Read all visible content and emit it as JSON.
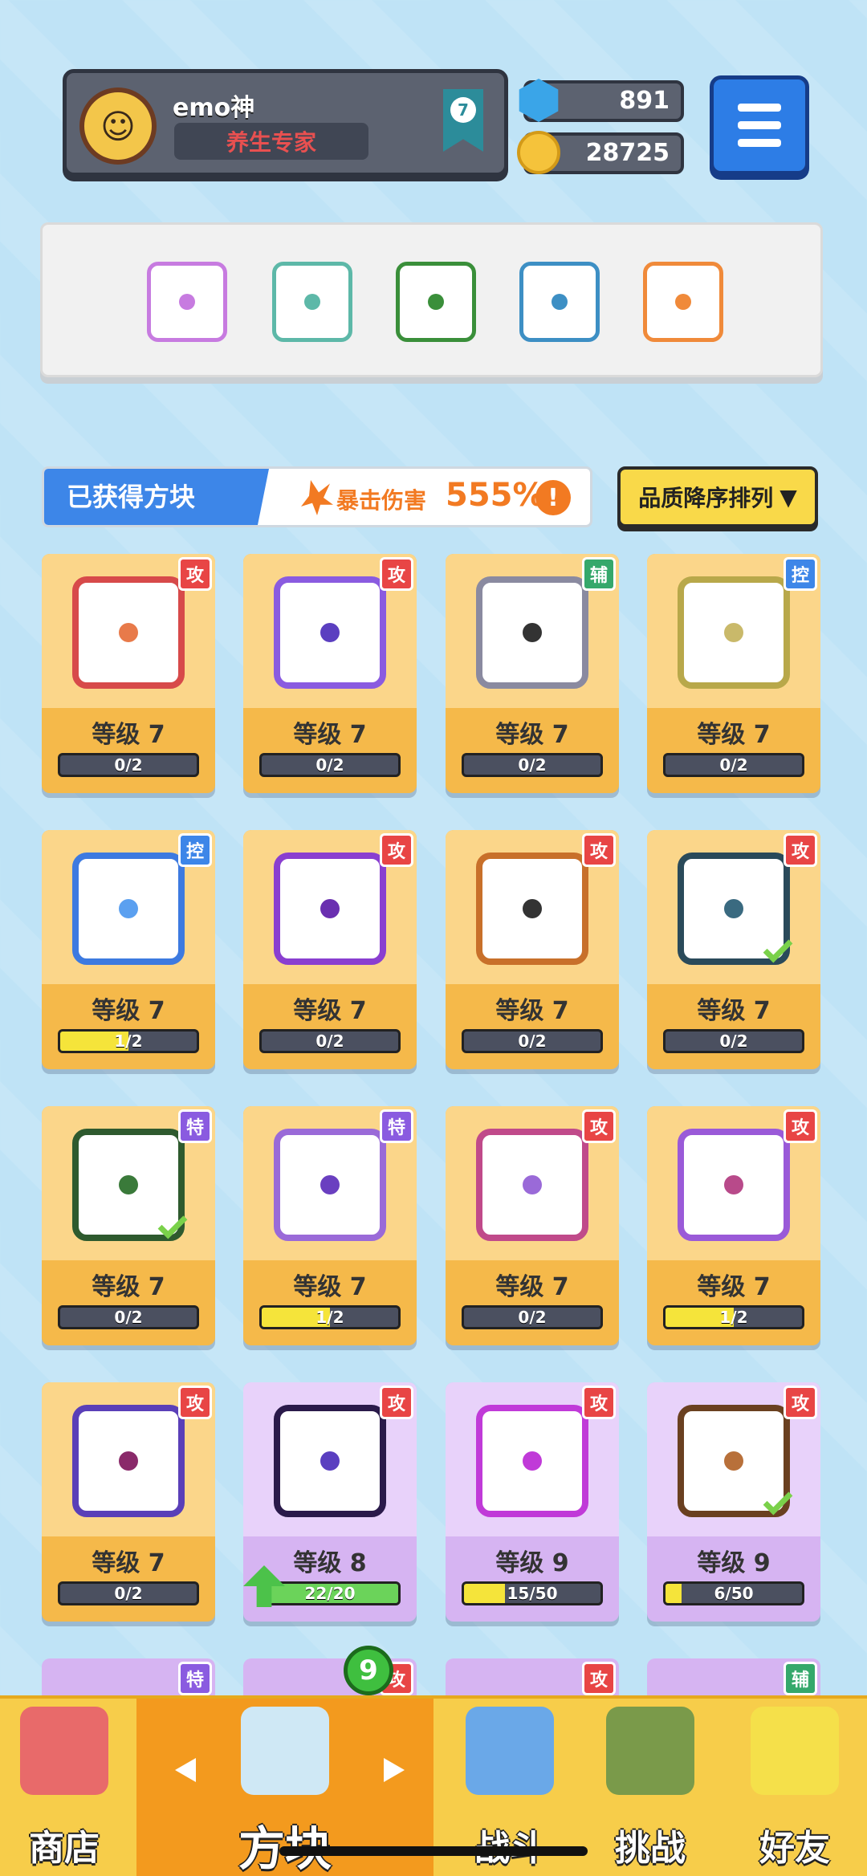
{
  "player": {
    "name": "emo神",
    "title": "养生专家",
    "rank": "7"
  },
  "currency": {
    "gems": "891",
    "coins": "28725"
  },
  "equipped_slots": [
    {
      "name": "rainbow-block",
      "color": "#c77be0"
    },
    {
      "name": "heal-block",
      "color": "#5db8a8"
    },
    {
      "name": "vine-block",
      "color": "#3a8f3a"
    },
    {
      "name": "vortex-block",
      "color": "#3d8fc4"
    },
    {
      "name": "target-block",
      "color": "#f08a3a"
    }
  ],
  "section": {
    "title": "已获得方块",
    "crit_label": "暴击伤害",
    "crit_value": "555%",
    "info": "!",
    "sort_label": "品质降序排列",
    "sort_arrow": "▼"
  },
  "cards": [
    {
      "type": "攻",
      "type_class": "atk",
      "level": "等级 7",
      "progress": "0/2",
      "fill": 0,
      "frame": "#d74a4a",
      "dot": "#e87a4a",
      "rarity": "gold"
    },
    {
      "type": "攻",
      "type_class": "atk",
      "level": "等级 7",
      "progress": "0/2",
      "fill": 0,
      "frame": "#8a5be0",
      "dot": "#5b3fc0",
      "rarity": "gold"
    },
    {
      "type": "辅",
      "type_class": "sup",
      "level": "等级 7",
      "progress": "0/2",
      "fill": 0,
      "frame": "#8a8aa0",
      "dot": "#333",
      "rarity": "gold"
    },
    {
      "type": "控",
      "type_class": "ctl",
      "level": "等级 7",
      "progress": "0/2",
      "fill": 0,
      "frame": "#b8a84a",
      "dot": "#c9b96a",
      "rarity": "gold"
    },
    {
      "type": "控",
      "type_class": "ctl",
      "level": "等级 7",
      "progress": "1/2",
      "fill": 0.5,
      "frame": "#3d7ae0",
      "dot": "#5ba0f0",
      "rarity": "gold"
    },
    {
      "type": "攻",
      "type_class": "atk",
      "level": "等级 7",
      "progress": "0/2",
      "fill": 0,
      "frame": "#8a3fd0",
      "dot": "#6a2fb0",
      "rarity": "gold"
    },
    {
      "type": "攻",
      "type_class": "atk",
      "level": "等级 7",
      "progress": "0/2",
      "fill": 0,
      "frame": "#c8702a",
      "dot": "#333",
      "rarity": "gold"
    },
    {
      "type": "攻",
      "type_class": "atk",
      "level": "等级 7",
      "progress": "0/2",
      "fill": 0,
      "frame": "#2a4a5a",
      "dot": "#3a6a80",
      "rarity": "gold",
      "check": true
    },
    {
      "type": "特",
      "type_class": "spc",
      "level": "等级 7",
      "progress": "0/2",
      "fill": 0,
      "frame": "#2e5a2e",
      "dot": "#3a7a3a",
      "rarity": "gold",
      "check": true
    },
    {
      "type": "特",
      "type_class": "spc",
      "level": "等级 7",
      "progress": "1/2",
      "fill": 0.5,
      "frame": "#9a6ad8",
      "dot": "#6a3fc0",
      "rarity": "gold"
    },
    {
      "type": "攻",
      "type_class": "atk",
      "level": "等级 7",
      "progress": "0/2",
      "fill": 0,
      "frame": "#c04a8a",
      "dot": "#9a6ad8",
      "rarity": "gold"
    },
    {
      "type": "攻",
      "type_class": "atk",
      "level": "等级 7",
      "progress": "1/2",
      "fill": 0.5,
      "frame": "#9a5ad8",
      "dot": "#b84a8a",
      "rarity": "gold"
    },
    {
      "type": "攻",
      "type_class": "atk",
      "level": "等级 7",
      "progress": "0/2",
      "fill": 0,
      "frame": "#5a3fb8",
      "dot": "#8a2a6a",
      "rarity": "gold"
    },
    {
      "type": "攻",
      "type_class": "atk",
      "level": "等级 8",
      "progress": "22/20",
      "fill": 1,
      "frame": "#2a1a4a",
      "dot": "#5a3fc0",
      "rarity": "purple",
      "upgrade": true
    },
    {
      "type": "攻",
      "type_class": "atk",
      "level": "等级 9",
      "progress": "15/50",
      "fill": 0.3,
      "frame": "#c03ad8",
      "dot": "#c03ad8",
      "rarity": "purple"
    },
    {
      "type": "攻",
      "type_class": "atk",
      "level": "等级 9",
      "progress": "6/50",
      "fill": 0.12,
      "frame": "#6a4020",
      "dot": "#b8703a",
      "rarity": "purple",
      "check": true
    }
  ],
  "peek_badges": [
    {
      "type": "特",
      "type_class": "spc"
    },
    {
      "type": "攻",
      "type_class": "atk"
    },
    {
      "type": "攻",
      "type_class": "atk"
    },
    {
      "type": "辅",
      "type_class": "sup"
    }
  ],
  "nav": {
    "items": [
      {
        "label": "商店",
        "key": "shop",
        "color": "#e86a6a"
      },
      {
        "label": "方块",
        "key": "blocks",
        "color": "#cfe8f5"
      },
      {
        "label": "战斗",
        "key": "battle",
        "color": "#6aa8e8"
      },
      {
        "label": "挑战",
        "key": "challenge",
        "color": "#7a9a4a"
      },
      {
        "label": "好友",
        "key": "friends",
        "color": "#f5e04a"
      }
    ],
    "badge": "9"
  }
}
